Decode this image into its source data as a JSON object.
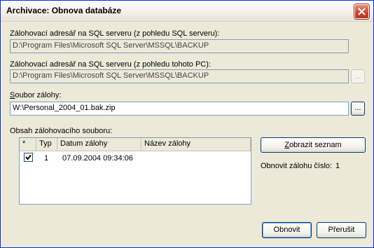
{
  "window": {
    "title": "Archivace: Obnova databáze"
  },
  "labels": {
    "backup_dir_server": "Zálohovací adresář na SQL serveru (z pohledu SQL serveru):",
    "backup_dir_pc": "Zálohovací adresář na SQL serveru (z pohledu tohoto PC):",
    "backup_file_underlined": "S",
    "backup_file_rest": "oubor zálohy:",
    "backup_content": "Obsah zálohovacího souboru:",
    "restore_number_label": "Obnovit zálohu číslo:",
    "restore_number_value": "1"
  },
  "fields": {
    "backup_dir_server": "D:\\Program Files\\Microsoft SQL Server\\MSSQL\\BACKUP",
    "backup_dir_pc": "D:\\Program Files\\Microsoft SQL Server\\MSSQL\\BACKUP",
    "backup_file": "W:\\Personal_2004_01.bak.zip"
  },
  "buttons": {
    "browse": "...",
    "show_list_underlined": "Z",
    "show_list_rest": "obrazit seznam",
    "restore": "Obnovit",
    "cancel": "Přerušit"
  },
  "table": {
    "columns": [
      "*",
      "Typ",
      "Datum zálohy",
      "Název zálohy"
    ],
    "rows": [
      {
        "checked": true,
        "type": "1",
        "date": "07.09.2004 09:34:06",
        "name": ""
      }
    ]
  }
}
